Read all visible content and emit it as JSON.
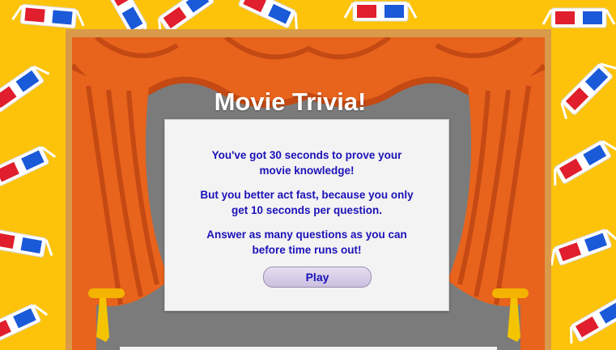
{
  "title": "Movie Trivia!",
  "intro": {
    "line1": "You've got 30 seconds to prove your movie knowledge!",
    "line2": "But you better act fast, because you only get 10 seconds per question.",
    "line3": "Answer as many questions as you can before time runs out!"
  },
  "play_button": {
    "label": "Play"
  },
  "colors": {
    "background": "#fcc30a",
    "curtain": "#e8631c",
    "text": "#1b12b8",
    "panel": "#f3f3f3"
  }
}
